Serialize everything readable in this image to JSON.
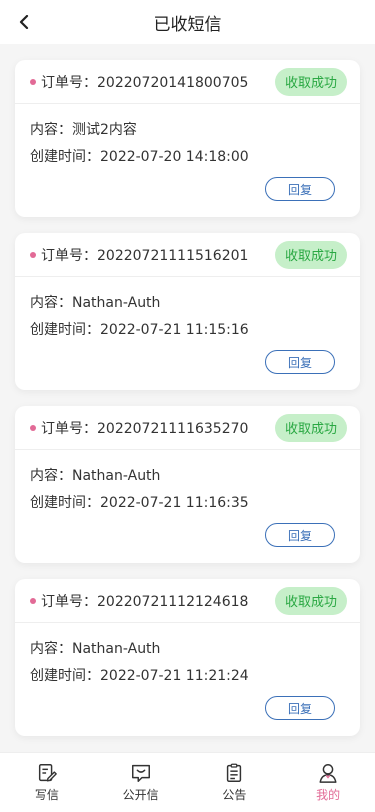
{
  "header": {
    "title": "已收短信"
  },
  "cards": [
    {
      "order_prefix": "订单号：",
      "order_no": "20220720141800705",
      "status": "收取成功",
      "content_label": "内容：",
      "content": "测试2内容",
      "time_label": "创建时间：",
      "time": "2022-07-20 14:18:00",
      "reply_label": "回复"
    },
    {
      "order_prefix": "订单号：",
      "order_no": "20220721111516201",
      "status": "收取成功",
      "content_label": "内容：",
      "content": "Nathan-Auth",
      "time_label": "创建时间：",
      "time": "2022-07-21 11:15:16",
      "reply_label": "回复"
    },
    {
      "order_prefix": "订单号：",
      "order_no": "20220721111635270",
      "status": "收取成功",
      "content_label": "内容：",
      "content": "Nathan-Auth",
      "time_label": "创建时间：",
      "time": "2022-07-21 11:16:35",
      "reply_label": "回复"
    },
    {
      "order_prefix": "订单号：",
      "order_no": "20220721112124618",
      "status": "收取成功",
      "content_label": "内容：",
      "content": "Nathan-Auth",
      "time_label": "创建时间：",
      "time": "2022-07-21 11:21:24",
      "reply_label": "回复"
    }
  ],
  "tabbar": {
    "items": [
      {
        "label": "写信",
        "icon": "edit-icon"
      },
      {
        "label": "公开信",
        "icon": "message-icon"
      },
      {
        "label": "公告",
        "icon": "clipboard-icon"
      },
      {
        "label": "我的",
        "icon": "user-icon",
        "active": true
      }
    ]
  },
  "colors": {
    "accent": "#e26a96",
    "success_bg": "#c6efc9",
    "success_text": "#2aa843",
    "reply_border": "#3b70b8"
  }
}
